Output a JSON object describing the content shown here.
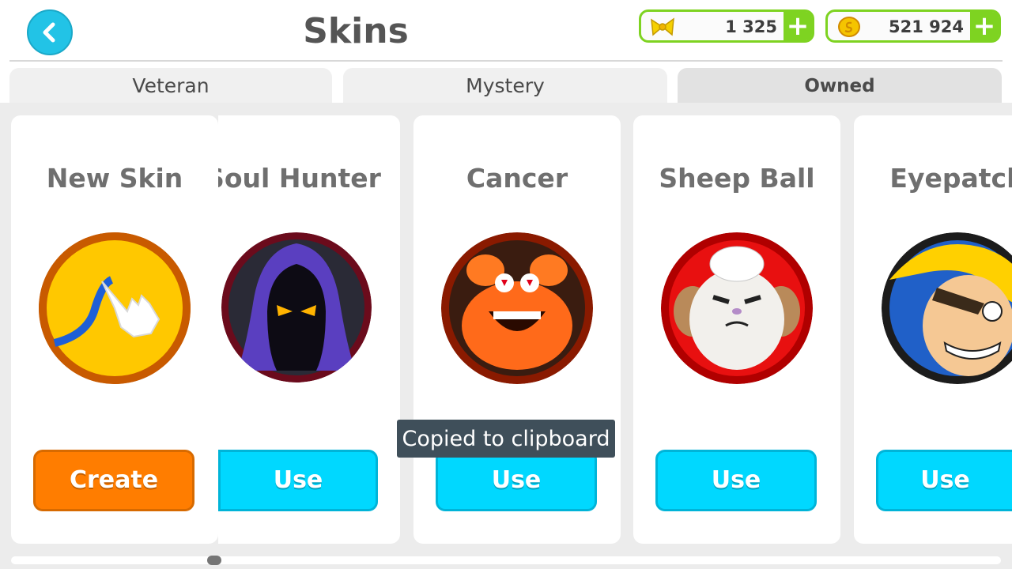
{
  "header": {
    "title": "Skins",
    "back_icon": "chevron-left-icon",
    "currencies": [
      {
        "icon": "bow-ribbon-icon",
        "value": "1 325",
        "plus": "+"
      },
      {
        "icon": "gold-coin-icon",
        "value": "521 924",
        "plus": "+"
      }
    ]
  },
  "tabs": [
    {
      "label": "Veteran",
      "active": false
    },
    {
      "label": "Mystery",
      "active": false
    },
    {
      "label": "Owned",
      "active": true
    }
  ],
  "skins": [
    {
      "name": "New Skin",
      "button": "Create",
      "icon": "draw-hand-icon"
    },
    {
      "name": "Soul Hunter",
      "button": "Use",
      "icon": "hooded-reaper-icon"
    },
    {
      "name": "Cancer",
      "button": "Use",
      "icon": "crab-icon"
    },
    {
      "name": "Sheep Ball",
      "button": "Use",
      "icon": "sheep-face-icon"
    },
    {
      "name": "Eyepatch",
      "button": "Use",
      "icon": "pirate-face-icon"
    }
  ],
  "toast": "Copied to clipboard",
  "colors": {
    "accent_green": "#7ed321",
    "use_button": "#00d8ff",
    "create_button": "#ff7d00",
    "back_button": "#22c3e6"
  }
}
